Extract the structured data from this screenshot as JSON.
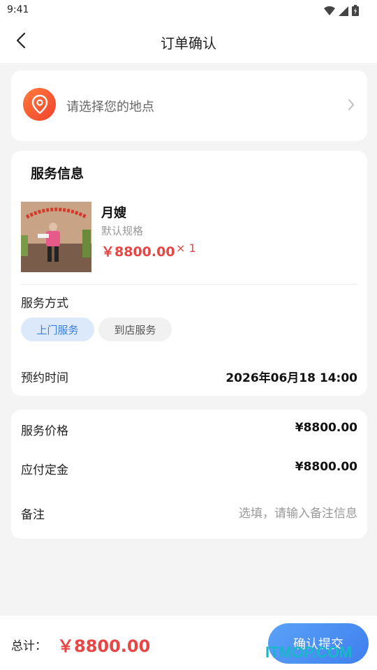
{
  "status_bar": {
    "time": "9:41"
  },
  "nav": {
    "title": "订单确认"
  },
  "location": {
    "placeholder": "请选择您的地点"
  },
  "service_info": {
    "title": "服务信息",
    "product": {
      "name": "月嫂",
      "spec": "默认规格",
      "price": "￥8800.00",
      "qty": "× 1"
    },
    "service_mode": {
      "label": "服务方式",
      "options": [
        "上门服务",
        "到店服务"
      ],
      "selected": "上门服务"
    },
    "appointment": {
      "label": "预约时间",
      "value": "2026年06月18 14:00"
    }
  },
  "pricing": {
    "service_price_label": "服务价格",
    "service_price_value": "¥8800.00",
    "deposit_label": "应付定金",
    "deposit_value": "¥8800.00",
    "remark_label": "备注",
    "remark_placeholder": "选填，请输入备注信息"
  },
  "footer": {
    "total_label": "总计：",
    "total_value": "￥8800.00",
    "submit_label": "确认提交"
  },
  "watermark": "ITMOP.COM",
  "colors": {
    "accent_red": "#e84545",
    "accent_blue": "#3f7fee",
    "chip_active_bg": "#dce9fb",
    "location_icon": "#f0432d"
  }
}
